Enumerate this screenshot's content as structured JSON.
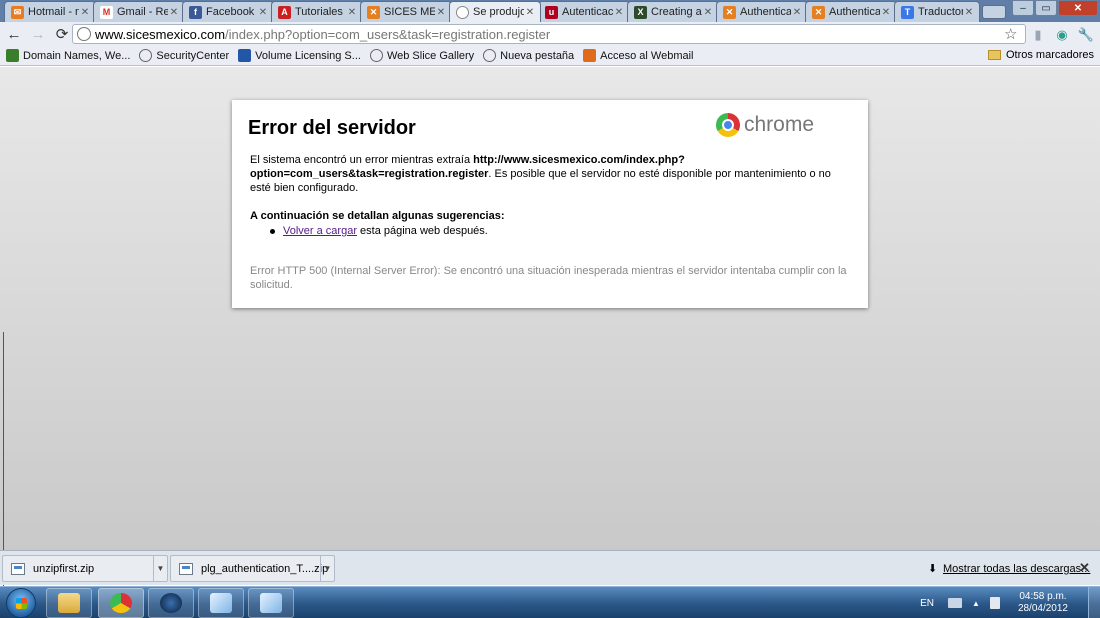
{
  "tabs": [
    {
      "title": "Hotmail - n",
      "icon": "hotmail-icon",
      "color": "#e97b23"
    },
    {
      "title": "Gmail - Rec",
      "icon": "gmail-icon",
      "color": "#d93025"
    },
    {
      "title": "Facebook",
      "icon": "facebook-icon",
      "color": "#3b5998"
    },
    {
      "title": "Tutoriales s",
      "icon": "adobe-icon",
      "color": "#cc1f1f"
    },
    {
      "title": "SICES MEXI",
      "icon": "joomla-icon",
      "color": "#e67e22"
    },
    {
      "title": "Se produjo",
      "icon": "page-icon",
      "color": "#ffffff"
    },
    {
      "title": "Autenticaci",
      "icon": "u-icon",
      "color": "#b00020"
    },
    {
      "title": "Creating an",
      "icon": "xpert-icon",
      "color": "#2d4a2d"
    },
    {
      "title": "Authenticat",
      "icon": "joomla-icon",
      "color": "#e67e22"
    },
    {
      "title": "Authenticat",
      "icon": "joomla-icon",
      "color": "#e67e22"
    },
    {
      "title": "Traductor d",
      "icon": "translate-icon",
      "color": "#3b78e7"
    }
  ],
  "omnibox": {
    "host": "www.sicesmexico.com",
    "path": "/index.php?option=com_users&task=registration.register"
  },
  "bookmarks": [
    {
      "label": "Domain Names, We...",
      "color": "#3a7d2a"
    },
    {
      "label": "SecurityCenter",
      "color": "#666666"
    },
    {
      "label": "Volume Licensing S...",
      "color": "#2456a8"
    },
    {
      "label": "Web Slice Gallery",
      "color": "#666666"
    },
    {
      "label": "Nueva pestaña",
      "color": "#666666"
    },
    {
      "label": "Acceso al Webmail",
      "color": "#e06a1c"
    }
  ],
  "bookmarks_other": "Otros marcadores",
  "error": {
    "title": "Error del servidor",
    "chrome_brand": "chrome",
    "msg_before": "El sistema encontró un error mientras extraía ",
    "msg_url": "http://www.sicesmexico.com/index.php?option=com_users&task=registration.register",
    "msg_after": ". Es posible que el servidor no esté disponible por mantenimiento o no esté bien configurado.",
    "suggestions_heading": "A continuación se detallan algunas sugerencias:",
    "suggestion_link": "Volver a cargar",
    "suggestion_rest": " esta página web después.",
    "detail": "Error HTTP 500 (Internal Server Error): Se encontró una situación inesperada mientras el servidor intentaba cumplir con la solicitud."
  },
  "downloads": [
    {
      "name": "unzipfirst.zip"
    },
    {
      "name": "plg_authentication_T....zip"
    }
  ],
  "show_all_downloads": "Mostrar todas las descargas...",
  "taskbar": {
    "language": "EN",
    "time": "04:58 p.m.",
    "date": "28/04/2012"
  }
}
